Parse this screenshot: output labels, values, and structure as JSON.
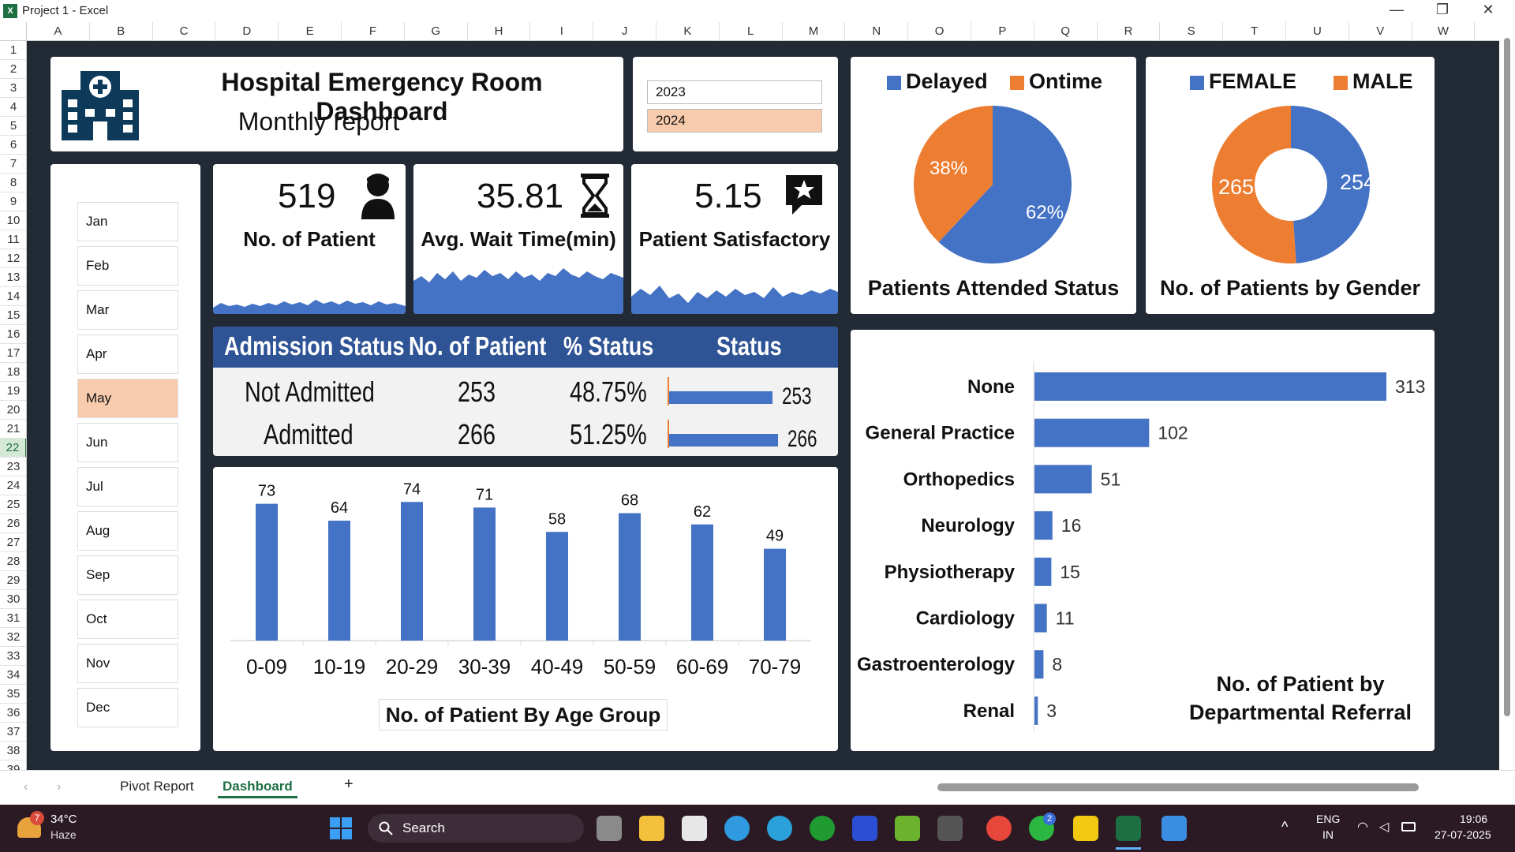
{
  "window": {
    "title": "Project 1 - Excel",
    "app_logo": "X",
    "min": "—",
    "restore": "❐",
    "close": "✕"
  },
  "columns": [
    "A",
    "B",
    "C",
    "D",
    "E",
    "F",
    "G",
    "H",
    "I",
    "J",
    "K",
    "L",
    "M",
    "N",
    "O",
    "P",
    "Q",
    "R",
    "S",
    "T",
    "U",
    "V",
    "W"
  ],
  "rows": [
    "1",
    "2",
    "3",
    "4",
    "5",
    "6",
    "7",
    "8",
    "9",
    "10",
    "11",
    "12",
    "13",
    "14",
    "15",
    "16",
    "17",
    "18",
    "19",
    "20",
    "21",
    "22",
    "23",
    "24",
    "25",
    "26",
    "27",
    "28",
    "29",
    "30",
    "31",
    "32",
    "33",
    "34",
    "35",
    "36",
    "37",
    "38",
    "39"
  ],
  "selected_row": "22",
  "header": {
    "title": "Hospital Emergency Room Dashboard",
    "subtitle": "Monthly report",
    "icon": "hospital-icon"
  },
  "years": {
    "y2023": "2023",
    "y2024": "2024",
    "selected": "2024"
  },
  "months": [
    "Jan",
    "Feb",
    "Mar",
    "Apr",
    "May",
    "Jun",
    "Jul",
    "Aug",
    "Sep",
    "Oct",
    "Nov",
    "Dec"
  ],
  "selected_month": "May",
  "kpis": {
    "patients": {
      "value": "519",
      "label": "No. of Patient",
      "icon": "person-icon"
    },
    "wait": {
      "value": "35.81",
      "label": "Avg. Wait Time(min)",
      "icon": "hourglass-icon"
    },
    "satisfaction": {
      "value": "5.15",
      "label": "Patient Satisfactory",
      "icon": "star-icon"
    }
  },
  "attended": {
    "legend": [
      "Delayed",
      "Ontime"
    ],
    "delayed_pct": "62%",
    "ontime_pct": "38%",
    "title": "Patients Attended Status",
    "values": [
      62,
      38
    ]
  },
  "gender": {
    "legend": [
      "FEMALE",
      "MALE"
    ],
    "female": "254",
    "male": "265",
    "title": "No. of Patients by Gender",
    "values": [
      254,
      265
    ]
  },
  "admission": {
    "headers": [
      "Admission Status",
      "No. of Patient",
      "% Status",
      "Status"
    ],
    "rows": [
      {
        "status": "Not Admitted",
        "count": "253",
        "pct": "48.75%",
        "bar": 253
      },
      {
        "status": "Admitted",
        "count": "266",
        "pct": "51.25%",
        "bar": 266
      }
    ]
  },
  "age_chart": {
    "title": "No. of Patient By Age Group"
  },
  "dept_chart": {
    "title_line1": "No. of Patient by",
    "title_line2": "Departmental Referral"
  },
  "chart_data": [
    {
      "type": "bar",
      "title": "No. of Patient By Age Group",
      "categories": [
        "0-09",
        "10-19",
        "20-29",
        "30-39",
        "40-49",
        "50-59",
        "60-69",
        "70-79"
      ],
      "values": [
        73,
        64,
        74,
        71,
        58,
        68,
        62,
        49
      ],
      "ylim": [
        0,
        80
      ]
    },
    {
      "type": "bar",
      "orientation": "horizontal",
      "title": "No. of Patient by Departmental Referral",
      "categories": [
        "None",
        "General Practice",
        "Orthopedics",
        "Neurology",
        "Physiotherapy",
        "Cardiology",
        "Gastroenterology",
        "Renal"
      ],
      "values": [
        313,
        102,
        51,
        16,
        15,
        11,
        8,
        3
      ]
    },
    {
      "type": "pie",
      "title": "Patients Attended Status",
      "categories": [
        "Delayed",
        "Ontime"
      ],
      "values": [
        62,
        38
      ]
    },
    {
      "type": "pie",
      "title": "No. of Patients by Gender",
      "categories": [
        "FEMALE",
        "MALE"
      ],
      "values": [
        254,
        265
      ]
    }
  ],
  "colors": {
    "blue": "#4472c4",
    "orange": "#ed7d31",
    "navy": "#0e3a5a",
    "highlight": "#f8cbad",
    "dark": "#222a35"
  },
  "sheets": [
    "Pivot Report",
    "Dashboard"
  ],
  "active_sheet": "Dashboard",
  "add_sheet": "+",
  "taskbar": {
    "temp": "34°C",
    "weather": "Haze",
    "badge": "7",
    "search": "Search",
    "lang1": "ENG",
    "lang2": "IN",
    "time": "19:06",
    "date": "27-07-2025",
    "whatsapp_badge": "2"
  }
}
